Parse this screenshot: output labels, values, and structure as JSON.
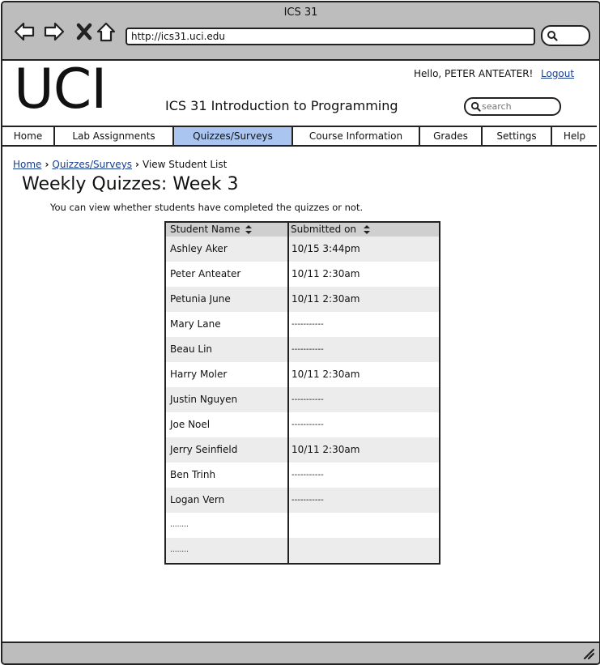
{
  "window": {
    "title": "ICS 31"
  },
  "browser": {
    "url": "http://ics31.uci.edu"
  },
  "header": {
    "logo": "UCI",
    "site_title": "ICS 31 Introduction to Programming",
    "greeting": "Hello, PETER ANTEATER!",
    "logout": "Logout",
    "search_placeholder": "search"
  },
  "tabs": [
    {
      "label": "Home"
    },
    {
      "label": "Lab Assignments"
    },
    {
      "label": "Quizzes/Surveys",
      "active": true
    },
    {
      "label": "Course Information"
    },
    {
      "label": "Grades"
    },
    {
      "label": "Settings"
    },
    {
      "label": "Help"
    }
  ],
  "breadcrumb": {
    "home": "Home",
    "quizzes": "Quizzes/Surveys",
    "current": "View Student List"
  },
  "page": {
    "heading": "Weekly Quizzes: Week 3",
    "subtitle": "You can view whether students have completed the quizzes or not."
  },
  "table": {
    "columns": [
      "Student Name",
      "Submitted on"
    ],
    "rows": [
      [
        "Ashley Aker",
        "10/15 3:44pm"
      ],
      [
        "Peter Anteater",
        "10/11 2:30am"
      ],
      [
        "Petunia June",
        "10/11 2:30am"
      ],
      [
        "Mary Lane",
        "-----------"
      ],
      [
        "Beau Lin",
        "-----------"
      ],
      [
        "Harry Moler",
        "10/11 2:30am"
      ],
      [
        "Justin Nguyen",
        "-----------"
      ],
      [
        "Joe Noel",
        "-----------"
      ],
      [
        "Jerry Seinfield",
        "10/11 2:30am"
      ],
      [
        "Ben Trinh",
        "-----------"
      ],
      [
        "Logan Vern",
        "-----------"
      ],
      [
        "........",
        ""
      ],
      [
        "........",
        ""
      ]
    ]
  },
  "colors": {
    "active_tab": "#a9c5f0",
    "link": "#1a3e8e",
    "chrome": "#bdbdbd"
  }
}
